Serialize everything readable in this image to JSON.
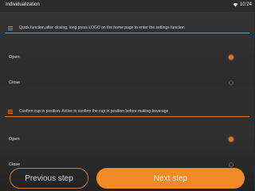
{
  "status_bar": {
    "title": "Individualization",
    "wifi_icon": "wifi-icon",
    "time": "10:24"
  },
  "sections": [
    {
      "text": "Quick function,after closing, long press LOGO on the home page to enter the settings function",
      "options": [
        {
          "label": "Open",
          "selected": true
        },
        {
          "label": "Close",
          "selected": false
        }
      ]
    },
    {
      "text": "Confirm cup in position. Active to confirm the cup in position before making beverage",
      "options": [
        {
          "label": "Open",
          "selected": true
        },
        {
          "label": "Close",
          "selected": false
        }
      ]
    }
  ],
  "buttons": {
    "previous": "Previous step",
    "next": "Next step"
  },
  "colors": {
    "accent": "#f28a26",
    "divider": "#d77a2c",
    "background": "#2e2e2e"
  }
}
